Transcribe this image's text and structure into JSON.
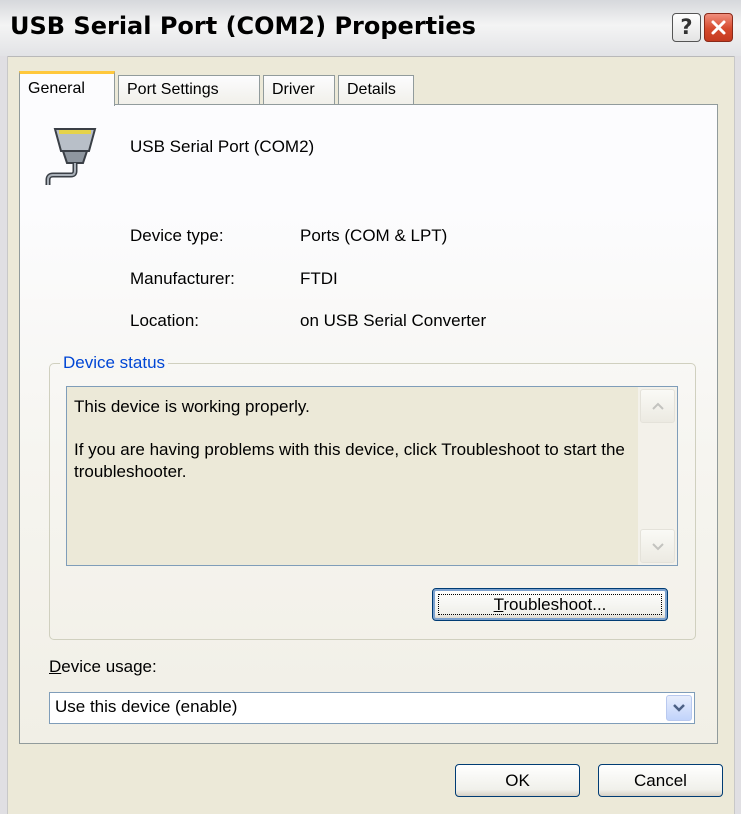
{
  "window": {
    "title": "USB Serial Port (COM2) Properties",
    "help_icon": "question-mark-icon",
    "close_icon": "close-x-icon"
  },
  "tabs": [
    {
      "label": "General",
      "active": true
    },
    {
      "label": "Port Settings",
      "active": false
    },
    {
      "label": "Driver",
      "active": false
    },
    {
      "label": "Details",
      "active": false
    }
  ],
  "device": {
    "icon": "serial-port-icon",
    "name": "USB Serial Port (COM2)"
  },
  "properties": [
    {
      "label": "Device type:",
      "value": "Ports (COM & LPT)"
    },
    {
      "label": "Manufacturer:",
      "value": "FTDI"
    },
    {
      "label": "Location:",
      "value": "on USB Serial Converter"
    }
  ],
  "device_status": {
    "legend": "Device status",
    "line1": "This device is working properly.",
    "line2": "If you are having problems with this device, click Troubleshoot to start the troubleshooter."
  },
  "buttons": {
    "troubleshoot_mnemonic": "T",
    "troubleshoot_rest": "roubleshoot...",
    "ok": "OK",
    "cancel": "Cancel"
  },
  "device_usage": {
    "label_mnemonic": "D",
    "label_rest": "evice usage:",
    "selected": "Use this device (enable)"
  },
  "colors": {
    "title_bar": "#e2e3e6",
    "close_button": "#d64a2d",
    "group_legend": "#0046d5",
    "active_tab_highlight": "#ffc83c",
    "window_face": "#ece9d8"
  }
}
